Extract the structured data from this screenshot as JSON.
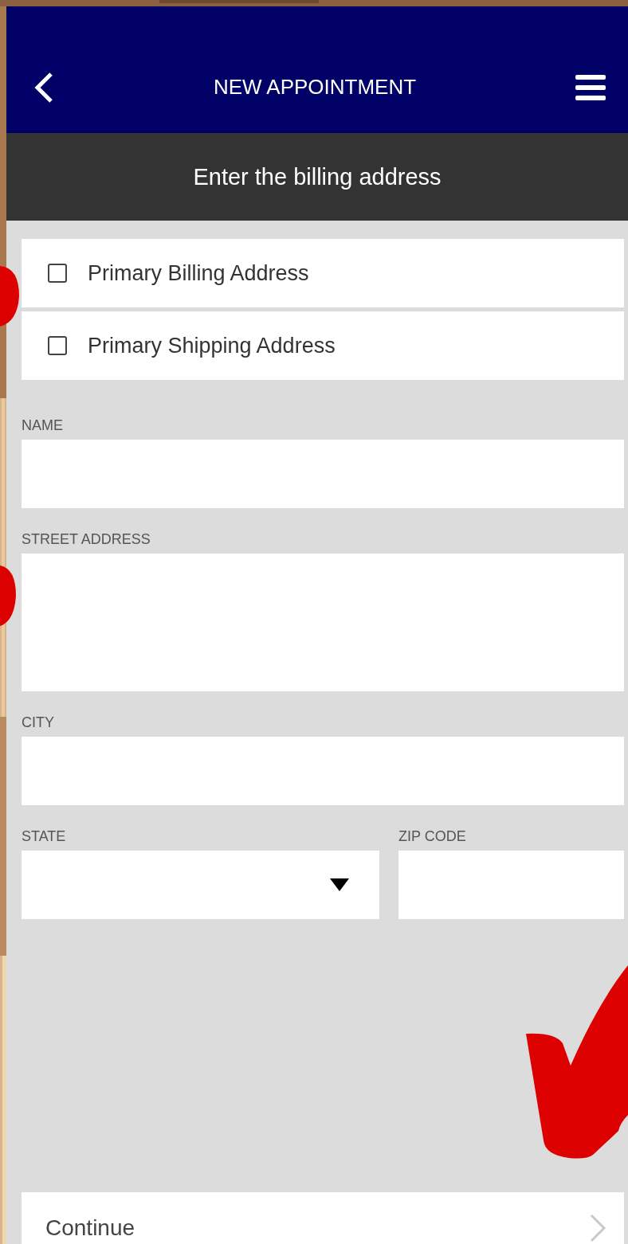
{
  "header": {
    "title": "NEW APPOINTMENT"
  },
  "subheader": {
    "title": "Enter the billing address"
  },
  "options": [
    {
      "label": "Primary Billing Address",
      "checked": false
    },
    {
      "label": "Primary Shipping Address",
      "checked": false
    }
  ],
  "fields": [
    {
      "label": "NAME",
      "kind": "text"
    },
    {
      "label": "STREET ADDRESS",
      "kind": "textarea"
    },
    {
      "label": "CITY",
      "kind": "text"
    }
  ],
  "address_row": [
    {
      "label": "STATE",
      "kind": "select"
    },
    {
      "label": "ZIP CODE",
      "kind": "text"
    }
  ],
  "continue_button": {
    "label": "Continue"
  }
}
